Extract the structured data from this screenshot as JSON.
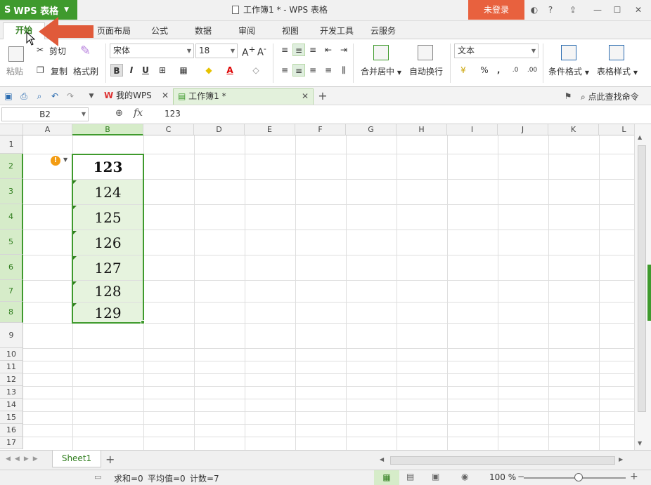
{
  "titlebar": {
    "app_menu_label": "WPS 表格",
    "app_logo": "S",
    "doc_title": "工作簿1 * - WPS 表格",
    "login_label": "未登录",
    "help_label": "?",
    "icons": [
      "skin-icon",
      "help-icon",
      "upload-icon",
      "minimize-icon",
      "maximize-icon",
      "close-icon"
    ]
  },
  "ribbon_tabs": [
    "开始",
    "页面布局",
    "公式",
    "数据",
    "审阅",
    "视图",
    "开发工具",
    "云服务"
  ],
  "active_tab": "开始",
  "ribbon": {
    "paste_label": "粘贴",
    "cut_label": "剪切",
    "copy_label": "复制",
    "format_painter_label": "格式刷",
    "font_name": "宋体",
    "font_size": "18",
    "bold": "B",
    "italic": "I",
    "underline": "U",
    "merge_center_label": "合并居中",
    "wrap_text_label": "自动换行",
    "number_format": "文本",
    "percent": "%",
    "comma": "‚",
    "cond_format_label": "条件格式",
    "table_style_label": "表格样式"
  },
  "quick_access": {
    "tabs": [
      {
        "label": "我的WPS",
        "active": false
      },
      {
        "label": "工作簿1 *",
        "active": true
      }
    ],
    "add_tab": "+",
    "find_command_label": "点此查找命令"
  },
  "formula_bar": {
    "name_box": "B2",
    "fx_label": "fx",
    "formula_value": "123"
  },
  "grid": {
    "columns": [
      "A",
      "B",
      "C",
      "D",
      "E",
      "F",
      "G",
      "H",
      "I",
      "J",
      "K",
      "L"
    ],
    "selected_column": "B",
    "rows": [
      "1",
      "2",
      "3",
      "4",
      "5",
      "6",
      "7",
      "8",
      "9",
      "10",
      "11",
      "12",
      "13",
      "14",
      "15",
      "16",
      "17"
    ],
    "selected_rows": [
      "2",
      "3",
      "4",
      "5",
      "6",
      "7",
      "8"
    ],
    "cells_B": [
      "123",
      "124",
      "125",
      "126",
      "127",
      "128",
      "129"
    ],
    "active_cell": "B2",
    "error_indicator": "!"
  },
  "sheets": {
    "tabs": [
      "Sheet1"
    ],
    "add_sheet": "+"
  },
  "status_bar": {
    "sum": "求和=0",
    "average": "平均值=0",
    "count": "计数=7",
    "zoom": "100 %",
    "zoom_minus": "−",
    "zoom_plus": "+"
  },
  "colors": {
    "accent_green": "#3f9a2d",
    "selection_fill": "#e6f3de",
    "login_orange": "#e8613e",
    "arrow_red": "#e05a3a"
  }
}
